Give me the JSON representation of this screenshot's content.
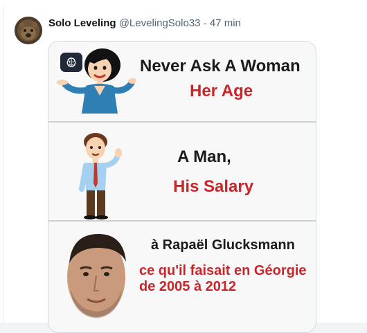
{
  "post": {
    "author_name": "Solo Leveling",
    "author_handle": "@LevelingSolo33",
    "separator": " · ",
    "time": "47 min"
  },
  "media": {
    "panel1": {
      "line1": "Never Ask A Woman",
      "line2": "Her Age"
    },
    "panel2": {
      "line1": "A Man,",
      "line2": "His Salary"
    },
    "panel3": {
      "line1": "à Rapaël Glucksmann",
      "line2": "ce qu'il faisait en Géorgie",
      "line3": "de 2005 à 2012"
    },
    "badge_icon": "brain-icon"
  },
  "colors": {
    "text_primary": "#0f1419",
    "text_secondary": "#536471",
    "meme_red": "#c8262a",
    "border": "#cfd9de"
  }
}
